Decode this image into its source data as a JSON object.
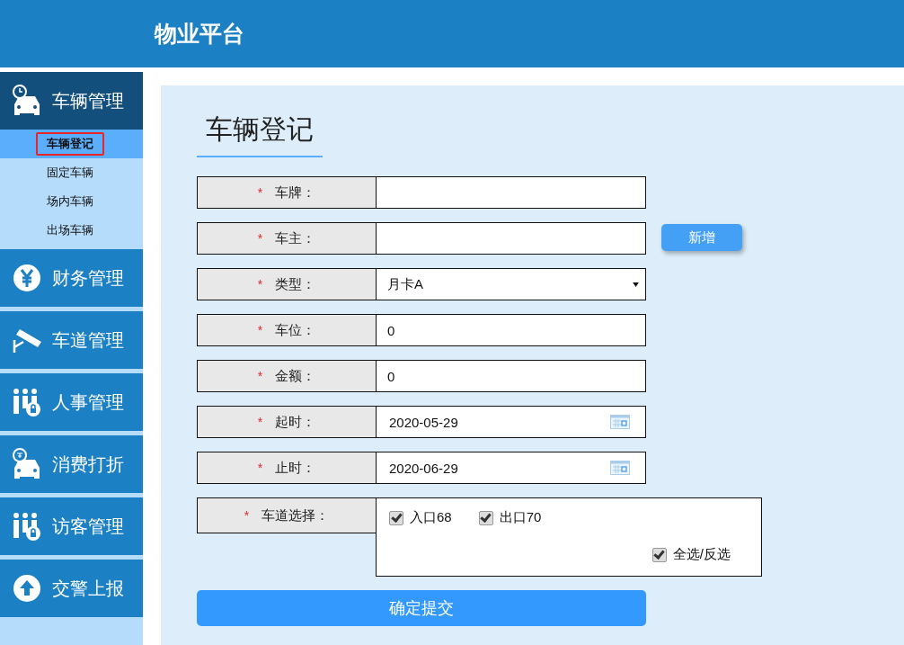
{
  "header": {
    "title": "物业平台"
  },
  "sidebar": {
    "items": [
      {
        "label": "车辆管理",
        "expanded": true,
        "children": [
          {
            "label": "车辆登记",
            "selected": true
          },
          {
            "label": "固定车辆",
            "selected": false
          },
          {
            "label": "场内车辆",
            "selected": false
          },
          {
            "label": "出场车辆",
            "selected": false
          }
        ]
      },
      {
        "label": "财务管理",
        "expanded": false
      },
      {
        "label": "车道管理",
        "expanded": false
      },
      {
        "label": "人事管理",
        "expanded": false
      },
      {
        "label": "消费打折",
        "expanded": false
      },
      {
        "label": "访客管理",
        "expanded": false
      },
      {
        "label": "交警上报",
        "expanded": false
      }
    ]
  },
  "form": {
    "title": "车辆登记",
    "fields": [
      {
        "kind": "text",
        "label": "车牌：",
        "required": "*"
      },
      {
        "kind": "text",
        "label": "车主：",
        "required": "*",
        "action": "新增"
      },
      {
        "kind": "select",
        "label": "类型：",
        "required": "*",
        "value": "月卡A"
      },
      {
        "kind": "text",
        "label": "车位：",
        "required": "*",
        "value": "0"
      },
      {
        "kind": "text",
        "label": "金额：",
        "required": "*",
        "value": "0"
      },
      {
        "kind": "date",
        "label": "起时：",
        "required": "*",
        "value": "2020-05-29"
      },
      {
        "kind": "date",
        "label": "止时：",
        "required": "*",
        "value": "2020-06-29"
      },
      {
        "kind": "checkboxes",
        "label": "车道选择：",
        "required": "*",
        "options": [
          {
            "label": "入口68",
            "checked": true
          },
          {
            "label": "出口70",
            "checked": true
          }
        ],
        "toggle_all": {
          "label": "全选/反选",
          "checked": true
        }
      }
    ],
    "submit": "确定提交"
  }
}
